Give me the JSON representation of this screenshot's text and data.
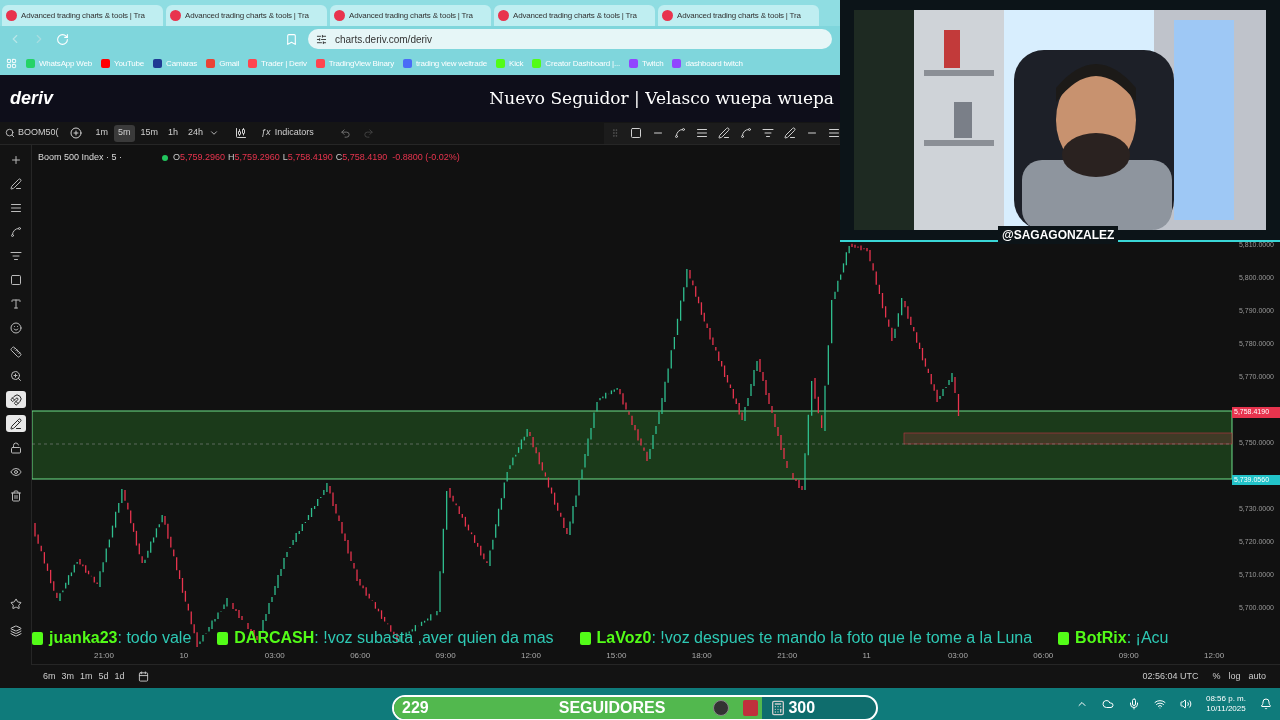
{
  "browser": {
    "tabs": [
      {
        "title": "Advanced trading charts & tools | Tra"
      },
      {
        "title": "Advanced trading charts & tools | Tra"
      },
      {
        "title": "Advanced trading charts & tools | Tra"
      },
      {
        "title": "Advanced trading charts & tools | Tra"
      },
      {
        "title": "Advanced trading charts & tools | Tra"
      }
    ],
    "address": "charts.deriv.com/deriv",
    "bookmarks": [
      {
        "label": "WhatsApp Web",
        "color": "#25d366"
      },
      {
        "label": "YouTube",
        "color": "#ff0000"
      },
      {
        "label": "Camaras",
        "color": "#1f3a93"
      },
      {
        "label": "Gmail",
        "color": "#ea4335"
      },
      {
        "label": "Trader | Deriv",
        "color": "#ff444f"
      },
      {
        "label": "TradingView Binary",
        "color": "#ff444f"
      },
      {
        "label": "trading view weltrade",
        "color": "#4a6cf7"
      },
      {
        "label": "Kick",
        "color": "#53fc18"
      },
      {
        "label": "Creator Dashboard |...",
        "color": "#53fc18"
      },
      {
        "label": "Twitch",
        "color": "#9146ff"
      },
      {
        "label": "dashboard twitch",
        "color": "#9146ff"
      }
    ]
  },
  "app": {
    "logo": "deriv",
    "alert": "Nuevo Seguidor | Velasco wuepa wuepa"
  },
  "toolbar": {
    "symbol": "BOOM50(",
    "intervals": [
      {
        "label": "1m",
        "selected": false
      },
      {
        "label": "5m",
        "selected": true
      },
      {
        "label": "15m",
        "selected": false
      },
      {
        "label": "1h",
        "selected": false
      },
      {
        "label": "24h",
        "selected": false
      }
    ],
    "indicators_symbol": "ƒx",
    "indicators": "Indicators"
  },
  "left_tools": [
    {
      "selected": false
    },
    {
      "selected": false
    },
    {
      "selected": false
    },
    {
      "selected": false
    },
    {
      "selected": false
    },
    {
      "selected": false
    },
    {
      "selected": false
    },
    {
      "selected": false
    },
    {
      "selected": false
    },
    {
      "selected": false
    },
    {
      "selected": true
    },
    {
      "selected": true
    },
    {
      "selected": false
    },
    {
      "selected": false
    },
    {
      "selected": false
    }
  ],
  "chart": {
    "title": "Boom 500 Index · 5 ·",
    "ohlc": [
      {
        "key": "O",
        "value": "5,759.2960"
      },
      {
        "key": "H",
        "value": "5,759.2960"
      },
      {
        "key": "L",
        "value": "5,758.4190"
      },
      {
        "key": "C",
        "value": "5,758.4190"
      }
    ],
    "change": "-0.8800 (-0.02%)",
    "price_ticks": [
      "5,810.0000",
      "5,800.0000",
      "5,790.0000",
      "5,780.0000",
      "5,770.0000",
      "5,750.0000",
      "5,730.0000",
      "5,720.0000",
      "5,710.0000",
      "5,700.0000"
    ],
    "price_badges": [
      {
        "value": "5,758.4190",
        "color": "#e8344e"
      },
      {
        "value": "5,739.0560",
        "color": "#22c3c9"
      }
    ],
    "time_ticks": [
      "21:00",
      "10",
      "03:00",
      "06:00",
      "09:00",
      "12:00",
      "15:00",
      "18:00",
      "21:00",
      "11",
      "03:00",
      "06:00",
      "09:00",
      "12:00"
    ]
  },
  "bottom_bar": {
    "ranges": [
      "6m",
      "3m",
      "1m",
      "5d",
      "1d"
    ],
    "clock": "02:56:04 UTC",
    "options": [
      "%",
      "log",
      "auto"
    ]
  },
  "chat_ticker": [
    {
      "user": "juanka23",
      "text": ": todo vale"
    },
    {
      "user": "DARCASH",
      "text": ": !voz subasta ,aver quien da mas"
    },
    {
      "user": "LaVoz0",
      "text": ": !voz despues te mando la foto que le tome a la Luna"
    },
    {
      "user": "BotRix",
      "text": ": ¡Acu"
    }
  ],
  "webcam": {
    "handle": "@SAGAGONZALEZ"
  },
  "goal": {
    "current": "229",
    "label": "SEGUIDORES",
    "target": "300",
    "level": 0.763
  },
  "taskbar": {
    "time": "08:56 p. m.",
    "date": "10/11/2025"
  }
}
